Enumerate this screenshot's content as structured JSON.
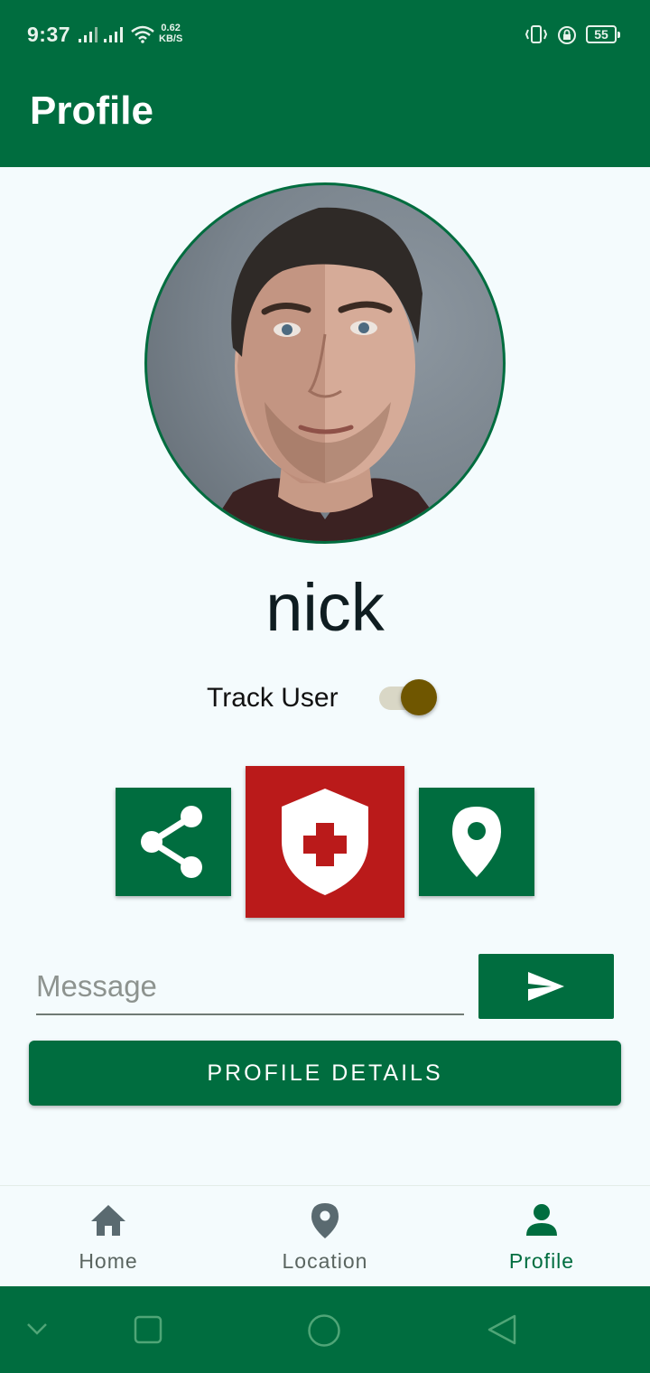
{
  "status_bar": {
    "time": "9:37",
    "net_speed_value": "0.62",
    "net_speed_unit": "KB/S",
    "battery": "55"
  },
  "app_bar": {
    "title": "Profile"
  },
  "profile": {
    "username": "nick",
    "track_label": "Track User",
    "track_enabled": true
  },
  "actions": {
    "share_icon": "share-icon",
    "sos_icon": "medical-shield-icon",
    "location_icon": "location-pin-icon"
  },
  "message": {
    "placeholder": "Message",
    "value": ""
  },
  "profile_details_label": "PROFILE DETAILS",
  "bottom_nav": {
    "items": [
      {
        "label": "Home",
        "icon": "home-icon",
        "active": false
      },
      {
        "label": "Location",
        "icon": "location-pin-icon",
        "active": false
      },
      {
        "label": "Profile",
        "icon": "person-icon",
        "active": true
      }
    ]
  },
  "colors": {
    "primary": "#006d3f",
    "danger": "#ba1a1a",
    "toggle_thumb": "#6f5600",
    "background": "#f4fbfd"
  }
}
